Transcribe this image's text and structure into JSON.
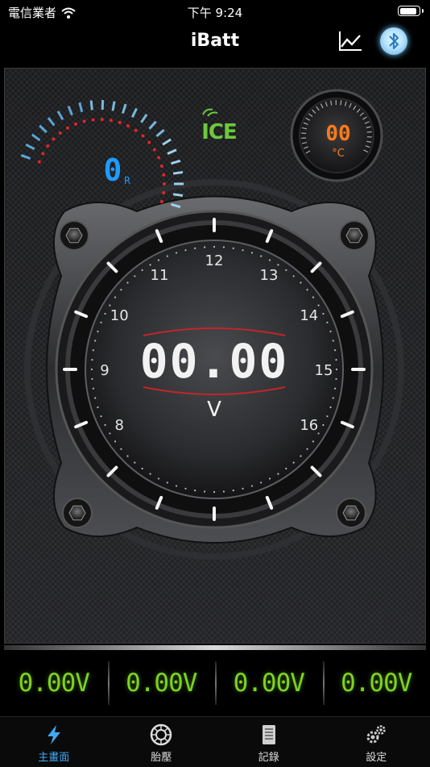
{
  "status_bar": {
    "carrier": "電信業者",
    "time": "下午 9:24"
  },
  "nav": {
    "title": "iBatt",
    "chart_icon": "line-chart-icon",
    "bluetooth_icon": "bluetooth-icon"
  },
  "gauge": {
    "voltage_display": "00.00",
    "unit": "V",
    "dial_labels": [
      "8",
      "9",
      "10",
      "11",
      "12",
      "13",
      "14",
      "15",
      "16"
    ],
    "logo": "ICE",
    "mini_display": "0",
    "mini_subscript": "R",
    "temperature": "00",
    "temp_unit": "°C"
  },
  "voltages": [
    "0.00V",
    "0.00V",
    "0.00V",
    "0.00V"
  ],
  "tabs": [
    {
      "label": "主畫面",
      "icon": "lightning-icon",
      "active": true
    },
    {
      "label": "胎壓",
      "icon": "tire-icon",
      "active": false
    },
    {
      "label": "記錄",
      "icon": "document-icon",
      "active": false
    },
    {
      "label": "設定",
      "icon": "gears-icon",
      "active": false
    }
  ],
  "colors": {
    "accent_blue": "#3fa9f5",
    "voltage_green": "#7ed321",
    "temp_orange": "#ff7a1a",
    "digital_blue": "#1e9bff",
    "logo_green": "#6cc93b"
  }
}
